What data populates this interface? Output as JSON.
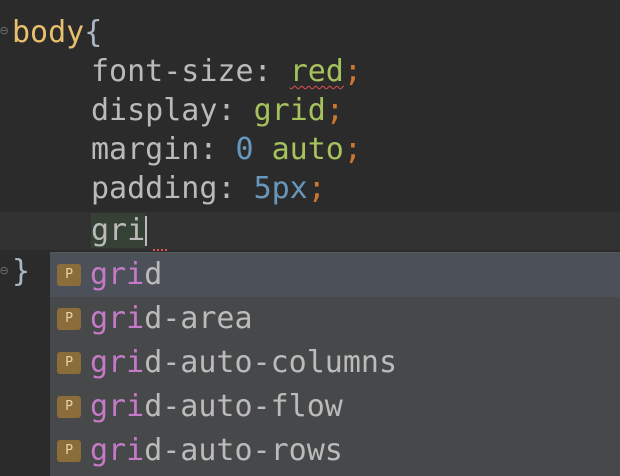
{
  "editor": {
    "line1": {
      "selector": "body",
      "open_brace": "{"
    },
    "line2": {
      "property": "font-size",
      "colon": ": ",
      "value": "red",
      "semicolon": ";"
    },
    "line3": {
      "property": "display",
      "colon": ": ",
      "value": "grid",
      "semicolon": ";"
    },
    "line4": {
      "property": "margin",
      "colon": ": ",
      "value_num": "0",
      "value_kw": " auto",
      "semicolon": ";"
    },
    "line5": {
      "property": "padding",
      "colon": ": ",
      "value_num": "5px",
      "semicolon": ";"
    },
    "line6": {
      "typed": "gri"
    },
    "line7": {
      "close_brace": "}"
    }
  },
  "completion": {
    "match_prefix": "gri",
    "badge": "P",
    "items": [
      {
        "rest": "d",
        "selected": true
      },
      {
        "rest": "d-area",
        "selected": false
      },
      {
        "rest": "d-auto-columns",
        "selected": false
      },
      {
        "rest": "d-auto-flow",
        "selected": false
      },
      {
        "rest": "d-auto-rows",
        "selected": false
      }
    ]
  },
  "colors": {
    "background": "#2b2b2b",
    "selector": "#e8bf6a",
    "property": "#bababa",
    "value_keyword": "#a5c25c",
    "value_number": "#6897bb",
    "semicolon": "#cc7832",
    "popup_bg": "#46484a",
    "popup_selected": "#4b5059",
    "match_highlight": "#c57ac7",
    "badge_bg": "#8a6d3b"
  }
}
